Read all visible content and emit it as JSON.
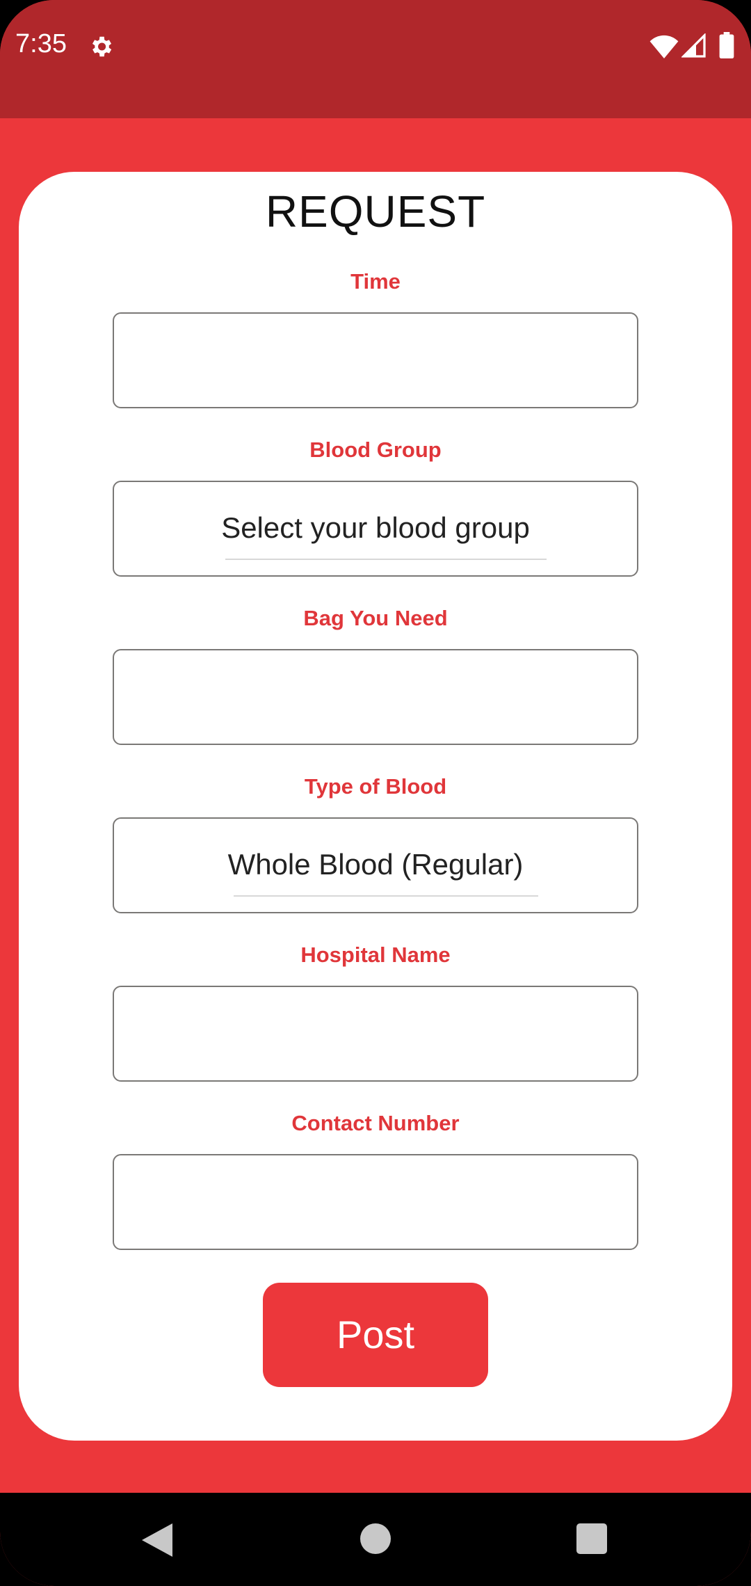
{
  "status_bar": {
    "time": "7:35",
    "icons": [
      "settings-icon",
      "wifi-icon",
      "signal-icon",
      "battery-icon"
    ]
  },
  "colors": {
    "status_bar": "#b0272b",
    "app_background": "#ec373b",
    "label": "#e0363a",
    "button": "#ec373b"
  },
  "form": {
    "title": "REQUEST",
    "fields": [
      {
        "label": "Time",
        "value": ""
      },
      {
        "label": "Blood Group",
        "value": "Select your blood group"
      },
      {
        "label": "Bag You Need",
        "value": ""
      },
      {
        "label": "Type of Blood",
        "value": "Whole Blood (Regular)"
      },
      {
        "label": "Hospital Name",
        "value": ""
      },
      {
        "label": "Contact Number",
        "value": ""
      }
    ],
    "submit_label": "Post"
  },
  "nav_bar": {
    "icons": [
      "back-icon",
      "home-icon",
      "recents-icon"
    ]
  }
}
